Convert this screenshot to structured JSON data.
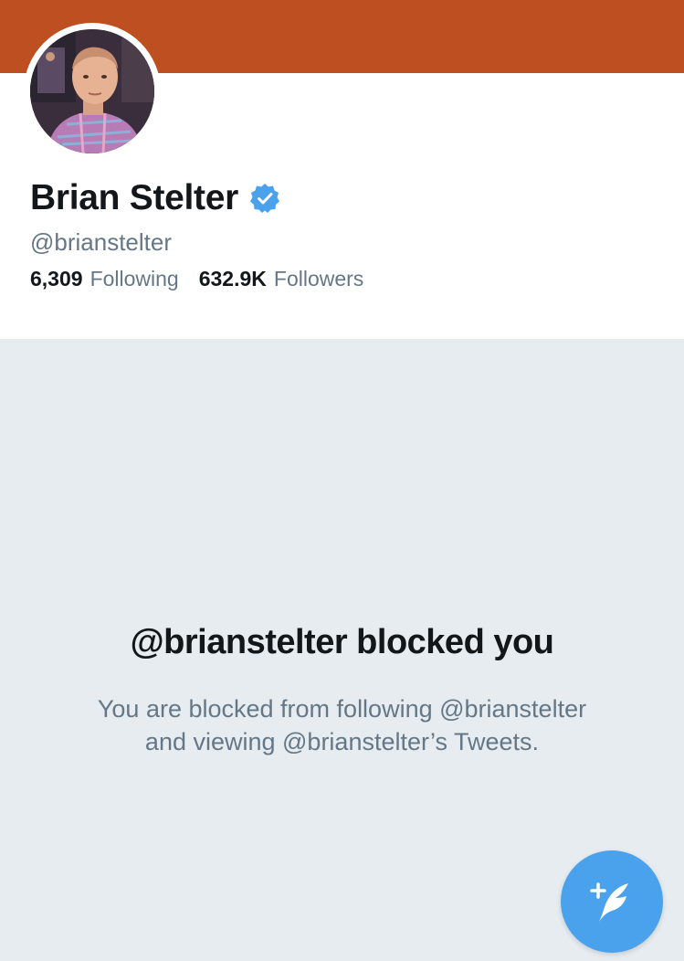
{
  "profile": {
    "name": "Brian Stelter",
    "handle": "@brianstelter",
    "verified": true,
    "following_count": "6,309",
    "following_label": "Following",
    "followers_count": "632.9K",
    "followers_label": "Followers"
  },
  "blocked": {
    "title": "@brianstelter blocked you",
    "line1": "You are blocked from following @brianstelter",
    "line2": "and viewing @brianstelter’s Tweets."
  },
  "icons": {
    "verified": "verified-badge-icon",
    "compose": "compose-tweet-icon"
  },
  "colors": {
    "banner": "#bd4f21",
    "accent": "#4aa1ec",
    "background": "#e6ecf0",
    "text_primary": "#14171a",
    "text_secondary": "#657786"
  }
}
